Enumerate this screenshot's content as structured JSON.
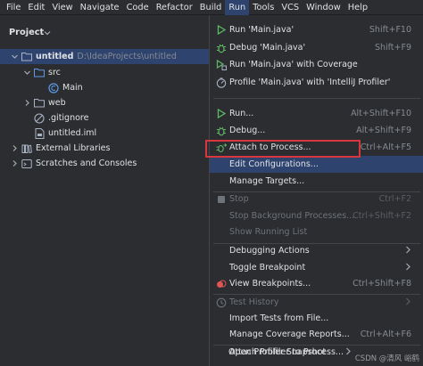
{
  "menubar": {
    "items": [
      "File",
      "Edit",
      "View",
      "Navigate",
      "Code",
      "Refactor",
      "Build",
      "Run",
      "Tools",
      "VCS",
      "Window",
      "Help"
    ],
    "active": "Run"
  },
  "project": {
    "title": "Project",
    "tree": [
      {
        "label": "untitled",
        "path": "D:\\IdeaProjects\\untitled",
        "icon": "folder-icon"
      },
      {
        "label": "src",
        "icon": "folder-icon"
      },
      {
        "label": "Main",
        "icon": "class-icon"
      },
      {
        "label": "web",
        "icon": "folder-icon"
      },
      {
        "label": ".gitignore",
        "icon": "ignore-file-icon"
      },
      {
        "label": "untitled.iml",
        "icon": "file-icon"
      },
      {
        "label": "External Libraries",
        "icon": "library-icon"
      },
      {
        "label": "Scratches and Consoles",
        "icon": "scratches-icon"
      }
    ]
  },
  "run_menu": {
    "items": [
      {
        "label": "Run 'Main.java'",
        "shortcut": "Shift+F10",
        "icon": "run-icon",
        "enabled": true
      },
      {
        "label": "Debug 'Main.java'",
        "shortcut": "Shift+F9",
        "icon": "debug-icon",
        "enabled": true
      },
      {
        "label": "Run 'Main.java' with Coverage",
        "shortcut": "",
        "icon": "coverage-icon",
        "enabled": true
      },
      {
        "label": "Profile 'Main.java' with 'IntelliJ Profiler'",
        "shortcut": "",
        "icon": "profiler-icon",
        "enabled": true
      },
      {
        "label": "Run...",
        "shortcut": "Alt+Shift+F10",
        "icon": "run-icon",
        "enabled": true
      },
      {
        "label": "Debug...",
        "shortcut": "Alt+Shift+F9",
        "icon": "debug-icon",
        "enabled": true
      },
      {
        "label": "Attach to Process...",
        "shortcut": "Ctrl+Alt+F5",
        "icon": "attach-icon",
        "enabled": true
      },
      {
        "label": "Edit Configurations...",
        "shortcut": "",
        "icon": "",
        "enabled": true
      },
      {
        "label": "Manage Targets...",
        "shortcut": "",
        "icon": "",
        "enabled": true
      },
      {
        "label": "Stop",
        "shortcut": "Ctrl+F2",
        "icon": "stop-icon",
        "enabled": false
      },
      {
        "label": "Stop Background Processes...",
        "shortcut": "Ctrl+Shift+F2",
        "icon": "",
        "enabled": false
      },
      {
        "label": "Show Running List",
        "shortcut": "",
        "icon": "",
        "enabled": false
      },
      {
        "label": "Debugging Actions",
        "shortcut": "",
        "icon": "",
        "enabled": true,
        "submenu": true
      },
      {
        "label": "Toggle Breakpoint",
        "shortcut": "",
        "icon": "",
        "enabled": true,
        "submenu": true
      },
      {
        "label": "View Breakpoints...",
        "shortcut": "Ctrl+Shift+F8",
        "icon": "breakpoints-icon",
        "enabled": true
      },
      {
        "label": "Test History",
        "shortcut": "",
        "icon": "history-icon",
        "enabled": false,
        "submenu": true
      },
      {
        "label": "Import Tests from File...",
        "shortcut": "",
        "icon": "",
        "enabled": true
      },
      {
        "label": "Manage Coverage Reports...",
        "shortcut": "Ctrl+Alt+F6",
        "icon": "",
        "enabled": true
      },
      {
        "label": "Attach Profiler to Process...",
        "shortcut": "",
        "icon": "",
        "enabled": true
      },
      {
        "label": "Open Profiler Snapshot",
        "shortcut": "",
        "icon": "",
        "enabled": true,
        "submenu": true
      }
    ],
    "highlighted": "Edit Configurations..."
  },
  "watermark": "CSDN @清风 峪鹤",
  "colors": {
    "accent": "#2e436e",
    "annotation": "#d9363e",
    "run": "#5fb865",
    "debug": "#5fb865",
    "breakpoint": "#e05555"
  }
}
